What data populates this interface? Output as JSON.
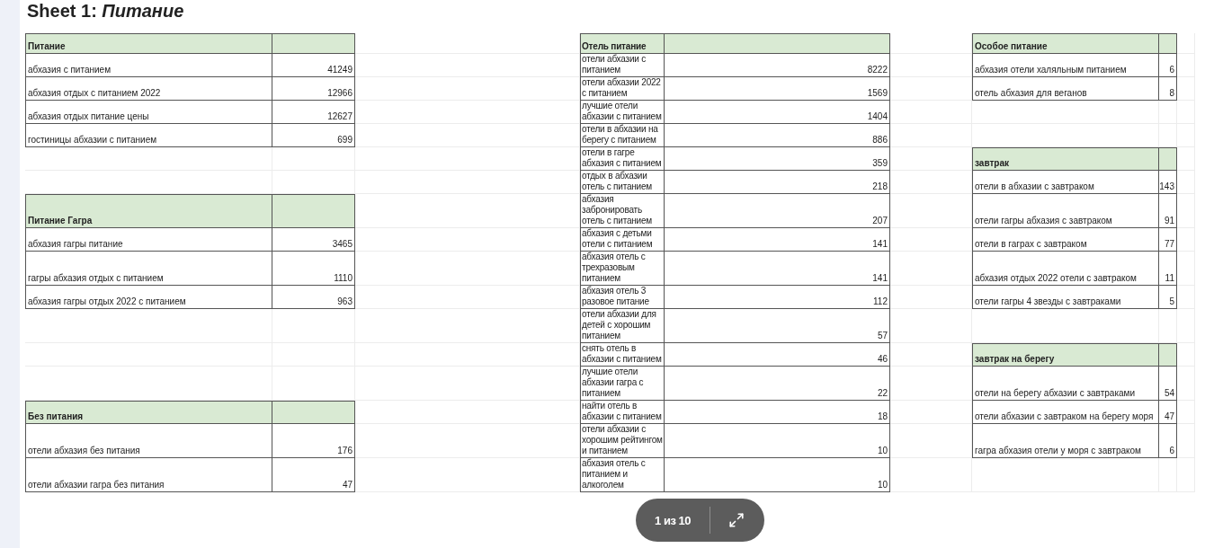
{
  "title": "Sheet 1: *Питание*",
  "rows": [
    {
      "cells": [
        {
          "kind": "header",
          "label": "Питание"
        },
        {
          "kind": "header",
          "label": "Отель питание"
        },
        {
          "kind": "header",
          "label": "Особое питание"
        }
      ]
    },
    {
      "cells": [
        {
          "kind": "item",
          "label": "абхазия с питанием",
          "value": "41249"
        },
        {
          "kind": "item",
          "label": "отели абхазии с питанием",
          "value": "8222"
        },
        {
          "kind": "item",
          "label": "абхазия отели халяльным питанием",
          "value": "6"
        }
      ]
    },
    {
      "cells": [
        {
          "kind": "item",
          "label": "абхазия отдых с питанием 2022",
          "value": "12966"
        },
        {
          "kind": "item",
          "label": "отели абхазии 2022 с питанием",
          "value": "1569"
        },
        {
          "kind": "item",
          "label": "отель абхазия для веганов",
          "value": "8"
        }
      ]
    },
    {
      "cells": [
        {
          "kind": "item",
          "label": "абхазия отдых питание цены",
          "value": "12627"
        },
        {
          "kind": "item",
          "label": "лучшие отели абхазии с питанием",
          "value": "1404"
        },
        {
          "kind": "blank"
        }
      ]
    },
    {
      "cells": [
        {
          "kind": "item",
          "label": "гостиницы абхазии с питанием",
          "value": "699"
        },
        {
          "kind": "item",
          "label": "отели в абхазии на берегу с питанием",
          "value": "886"
        },
        {
          "kind": "blank"
        }
      ]
    },
    {
      "cells": [
        {
          "kind": "blank"
        },
        {
          "kind": "item",
          "label": "отели в гагре абхазия с питанием",
          "value": "359"
        },
        {
          "kind": "header",
          "label": "завтрак"
        }
      ]
    },
    {
      "cells": [
        {
          "kind": "blank"
        },
        {
          "kind": "item",
          "label": "отдых в абхазии отель с питанием",
          "value": "218"
        },
        {
          "kind": "item",
          "label": "отели в абхазии с завтраком",
          "value": "143"
        }
      ]
    },
    {
      "cells": [
        {
          "kind": "header",
          "label": "Питание Гагра"
        },
        {
          "kind": "item",
          "label": "абхазия забронировать отель с питанием",
          "value": "207"
        },
        {
          "kind": "item",
          "label": "отели гагры абхазия с завтраком",
          "value": "91"
        }
      ]
    },
    {
      "cells": [
        {
          "kind": "item",
          "label": "абхазия гагры питание",
          "value": "3465"
        },
        {
          "kind": "item",
          "label": "абхазия с детьми отели с питанием",
          "value": "141"
        },
        {
          "kind": "item",
          "label": "отели в гаграх с завтраком",
          "value": "77"
        }
      ]
    },
    {
      "cells": [
        {
          "kind": "item",
          "label": "гагры абхазия отдых с питанием",
          "value": "1110"
        },
        {
          "kind": "item",
          "label": "абхазия отель с трехразовым питанием",
          "value": "141"
        },
        {
          "kind": "item",
          "label": "абхазия отдых 2022 отели с завтраком",
          "value": "11"
        }
      ]
    },
    {
      "cells": [
        {
          "kind": "item",
          "label": "абхазия гагры отдых 2022 с питанием",
          "value": "963"
        },
        {
          "kind": "item",
          "label": "абхазия отель 3 разовое питание",
          "value": "112"
        },
        {
          "kind": "item",
          "label": "отели гагры 4 звезды с завтраками",
          "value": "5"
        }
      ]
    },
    {
      "cells": [
        {
          "kind": "blank"
        },
        {
          "kind": "item",
          "label": "отели абхазии для детей с хорошим питанием",
          "value": "57"
        },
        {
          "kind": "blank"
        }
      ]
    },
    {
      "cells": [
        {
          "kind": "blank"
        },
        {
          "kind": "item",
          "label": "снять отель в абхазии с питанием",
          "value": "46"
        },
        {
          "kind": "header",
          "label": "завтрак на берегу"
        }
      ]
    },
    {
      "cells": [
        {
          "kind": "blank"
        },
        {
          "kind": "item",
          "label": "лучшие отели абхазии гагра с питанием",
          "value": "22"
        },
        {
          "kind": "item",
          "label": "отели на берегу абхазии с завтраками",
          "value": "54"
        }
      ]
    },
    {
      "cells": [
        {
          "kind": "header",
          "label": "Без питания"
        },
        {
          "kind": "item",
          "label": "найти отель в абхазии с питанием",
          "value": "18"
        },
        {
          "kind": "item",
          "label": "отели абхазии с завтраком на берегу моря",
          "value": "47"
        }
      ]
    },
    {
      "cells": [
        {
          "kind": "item",
          "label": "отели абхазия без питания",
          "value": "176"
        },
        {
          "kind": "item",
          "label": "отели абхазии с хорошим рейтингом и питанием",
          "value": "10"
        },
        {
          "kind": "item",
          "label": "гагра абхазия отели у моря с завтраком",
          "value": "6"
        }
      ]
    },
    {
      "cells": [
        {
          "kind": "item",
          "label": "отели абхазии гагра без питания",
          "value": "47"
        },
        {
          "kind": "item",
          "label": "абхазия отель с питанием и алкоголем",
          "value": "10"
        },
        {
          "kind": "blank"
        }
      ]
    }
  ],
  "viewer": {
    "page_indicator": "1 из 10"
  }
}
